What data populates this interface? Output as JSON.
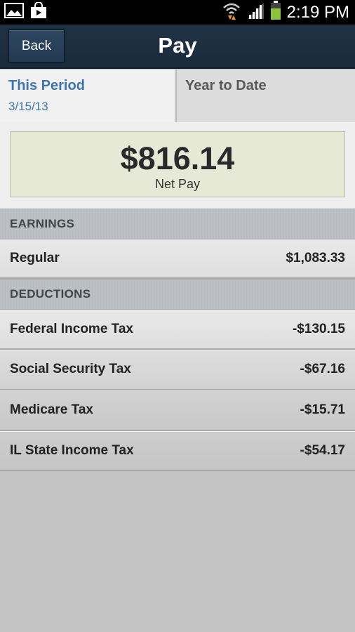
{
  "status_bar": {
    "time": "2:19 PM",
    "icons": [
      "gallery-icon",
      "store-icon",
      "wifi-icon",
      "signal-icon",
      "battery-icon"
    ]
  },
  "header": {
    "back_label": "Back",
    "title": "Pay"
  },
  "tabs": [
    {
      "label": "This Period",
      "date": "3/15/13",
      "active": true
    },
    {
      "label": "Year to Date",
      "active": false
    }
  ],
  "net_pay": {
    "amount": "$816.14",
    "label": "Net Pay"
  },
  "earnings": {
    "header": "EARNINGS",
    "items": [
      {
        "label": "Regular",
        "amount": "$1,083.33"
      }
    ]
  },
  "deductions": {
    "header": "DEDUCTIONS",
    "items": [
      {
        "label": "Federal Income Tax",
        "amount": "-$130.15"
      },
      {
        "label": "Social Security Tax",
        "amount": "-$67.16"
      },
      {
        "label": "Medicare Tax",
        "amount": "-$15.71"
      },
      {
        "label": "IL State Income Tax",
        "amount": "-$54.17"
      }
    ]
  },
  "colors": {
    "header_bg": "#1f3244",
    "accent_blue": "#3d75b3",
    "net_pay_bg": "#e6e9d6",
    "battery_green": "#8bc53f"
  }
}
